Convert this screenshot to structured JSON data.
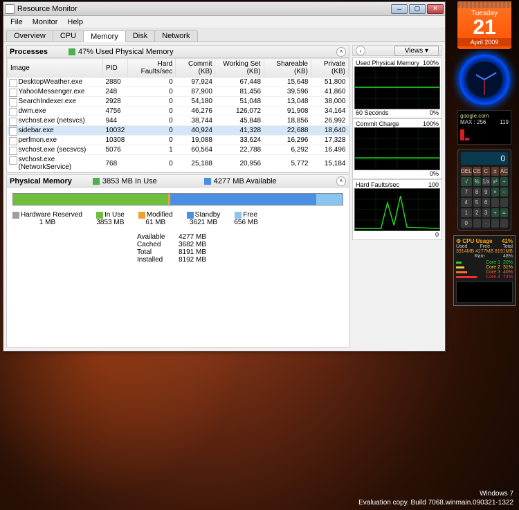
{
  "window": {
    "title": "Resource Monitor",
    "menus": [
      "File",
      "Monitor",
      "Help"
    ],
    "tabs": [
      "Overview",
      "CPU",
      "Memory",
      "Disk",
      "Network"
    ],
    "active_tab": 2
  },
  "processes_panel": {
    "title": "Processes",
    "summary": "47% Used Physical Memory",
    "columns": [
      "Image",
      "PID",
      "Hard Faults/sec",
      "Commit (KB)",
      "Working Set (KB)",
      "Shareable (KB)",
      "Private (KB)"
    ],
    "rows": [
      {
        "image": "DesktopWeather.exe",
        "pid": "2880",
        "hf": "0",
        "commit": "97,924",
        "ws": "67,448",
        "sh": "15,648",
        "priv": "51,800"
      },
      {
        "image": "YahooMessenger.exe",
        "pid": "248",
        "hf": "0",
        "commit": "87,900",
        "ws": "81,456",
        "sh": "39,596",
        "priv": "41,860"
      },
      {
        "image": "SearchIndexer.exe",
        "pid": "2928",
        "hf": "0",
        "commit": "54,180",
        "ws": "51,048",
        "sh": "13,048",
        "priv": "38,000"
      },
      {
        "image": "dwm.exe",
        "pid": "4756",
        "hf": "0",
        "commit": "46,276",
        "ws": "126,072",
        "sh": "91,908",
        "priv": "34,164"
      },
      {
        "image": "svchost.exe (netsvcs)",
        "pid": "944",
        "hf": "0",
        "commit": "38,744",
        "ws": "45,848",
        "sh": "18,856",
        "priv": "26,992"
      },
      {
        "image": "sidebar.exe",
        "pid": "10032",
        "hf": "0",
        "commit": "40,924",
        "ws": "41,328",
        "sh": "22,688",
        "priv": "18,640",
        "selected": true
      },
      {
        "image": "perfmon.exe",
        "pid": "10308",
        "hf": "0",
        "commit": "19,088",
        "ws": "33,624",
        "sh": "16,296",
        "priv": "17,328"
      },
      {
        "image": "svchost.exe (secsvcs)",
        "pid": "5076",
        "hf": "1",
        "commit": "60,564",
        "ws": "22,788",
        "sh": "6,292",
        "priv": "16,496"
      },
      {
        "image": "svchost.exe (NetworkService)",
        "pid": "768",
        "hf": "0",
        "commit": "25,188",
        "ws": "20,956",
        "sh": "5,772",
        "priv": "15,184"
      }
    ]
  },
  "memory_panel": {
    "title": "Physical Memory",
    "in_use_label": "3853 MB In Use",
    "avail_label": "4277 MB Available",
    "legend": [
      {
        "name": "Hardware Reserved",
        "value": "1 MB",
        "color": "#9e9e9e"
      },
      {
        "name": "In Use",
        "value": "3853 MB",
        "color": "#6fbf3f"
      },
      {
        "name": "Modified",
        "value": "61 MB",
        "color": "#f0a030"
      },
      {
        "name": "Standby",
        "value": "3621 MB",
        "color": "#4a90e2"
      },
      {
        "name": "Free",
        "value": "656 MB",
        "color": "#8ac4f0"
      }
    ],
    "stats": [
      {
        "label": "Available",
        "value": "4277 MB"
      },
      {
        "label": "Cached",
        "value": "3682 MB"
      },
      {
        "label": "Total",
        "value": "8191 MB"
      },
      {
        "label": "Installed",
        "value": "8192 MB"
      }
    ]
  },
  "graphs": {
    "views_label": "Views",
    "items": [
      {
        "title": "Used Physical Memory",
        "max": "100%",
        "bottom_left": "60 Seconds",
        "bottom_right": "0%"
      },
      {
        "title": "Commit Charge",
        "max": "100%",
        "bottom_left": "",
        "bottom_right": "0%"
      },
      {
        "title": "Hard Faults/sec",
        "max": "100",
        "bottom_left": "",
        "bottom_right": "0"
      }
    ]
  },
  "calendar": {
    "weekday": "Tuesday",
    "day": "21",
    "month": "April 2009"
  },
  "net_gadget": {
    "host": "google.com",
    "label": "MAX :",
    "value": "256",
    "stat": "119"
  },
  "calculator": {
    "display": "0",
    "buttons": [
      [
        "DEL",
        "CE",
        "C",
        "±",
        "AC"
      ],
      [
        "√",
        "%",
        "1/x",
        "x²",
        "÷"
      ],
      [
        "7",
        "8",
        "9",
        "×",
        "−"
      ],
      [
        "4",
        "5",
        "6",
        "",
        ""
      ],
      [
        "1",
        "2",
        "3",
        "+",
        "="
      ],
      [
        "0",
        "",
        "·",
        "",
        ""
      ]
    ]
  },
  "cpu_gadget": {
    "title": "CPU Usage",
    "pct": "41%",
    "head": [
      "Used",
      "Free",
      "Total"
    ],
    "mem": [
      "3914MB",
      "4277MB",
      "8191MB"
    ],
    "ram_label": "Ram",
    "ram_pct": "48%",
    "cores": [
      {
        "name": "Core 1",
        "pct": "20%",
        "color": "#30d030"
      },
      {
        "name": "Core 2",
        "pct": "31%",
        "color": "#f0d030"
      },
      {
        "name": "Core 3",
        "pct": "40%",
        "color": "#f07030"
      },
      {
        "name": "Core 4",
        "pct": "74%",
        "color": "#f03030"
      }
    ]
  },
  "watermark": {
    "line1": "Windows 7",
    "line2": "Evaluation copy. Build 7068.winmain.090321-1322"
  }
}
